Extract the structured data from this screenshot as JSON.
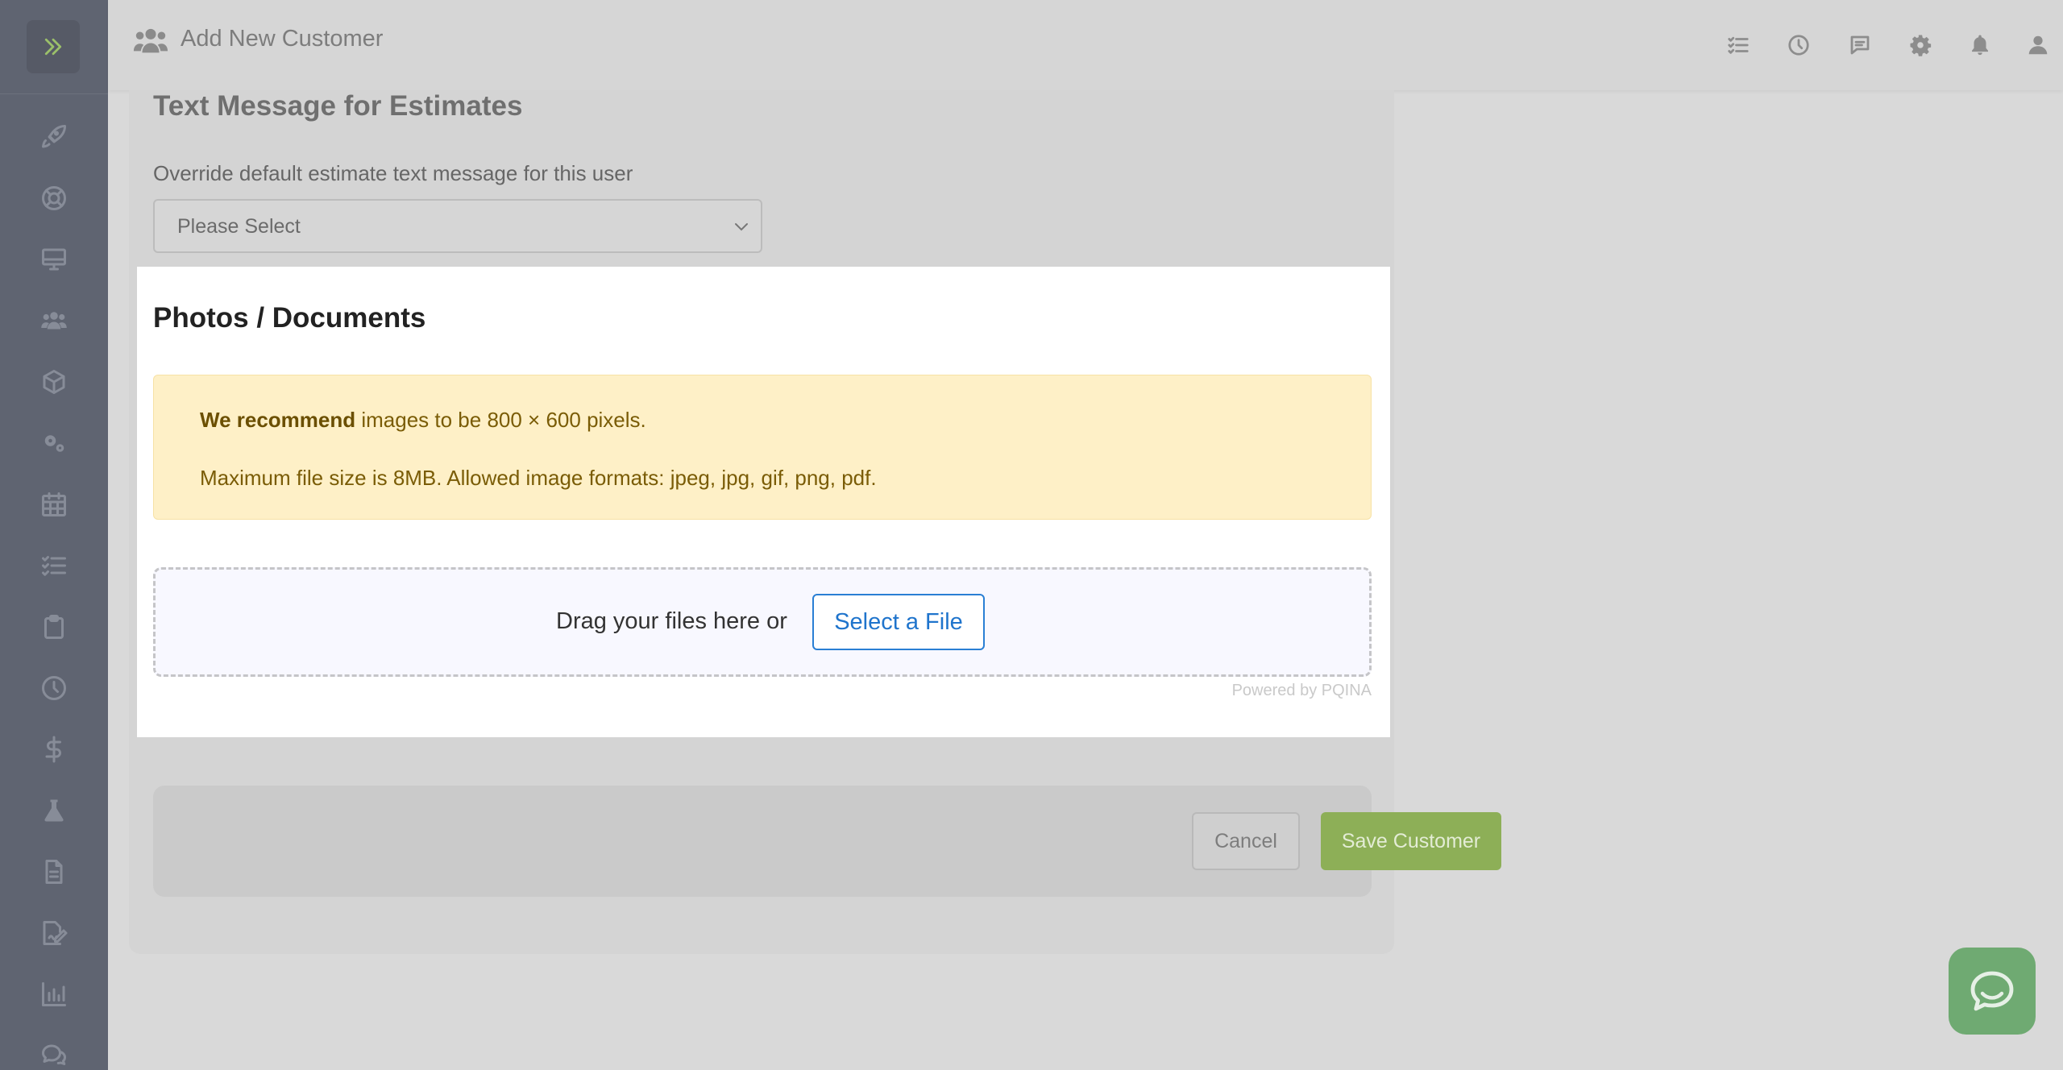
{
  "header": {
    "title": "Add New Customer",
    "title_icon": "users-icon",
    "icons": [
      "task-list-icon",
      "clock-icon",
      "message-icon",
      "gear-icon",
      "bell-icon",
      "user-icon"
    ]
  },
  "sidebar": {
    "toggle_icon": "double-chevron-right-icon",
    "items": [
      "rocket-icon",
      "lifebuoy-icon",
      "monitor-icon",
      "users-icon",
      "box-icon",
      "gears-icon",
      "calendar-icon",
      "checklist-icon",
      "clipboard-icon",
      "clock-icon",
      "dollar-icon",
      "flask-icon",
      "document-icon",
      "signature-icon",
      "bar-chart-icon",
      "chat-bubbles-icon"
    ]
  },
  "text_message": {
    "title": "Text Message for Estimates",
    "label": "Override default estimate text message for this user",
    "select_value": "Please Select"
  },
  "photos": {
    "title": "Photos / Documents",
    "alert_bold": "We recommend",
    "alert_line1_rest": " images to be 800 × 600 pixels.",
    "alert_line2": "Maximum file size is 8MB. Allowed image formats: jpeg, jpg, gif, png, pdf.",
    "drop_text": "Drag your files here or",
    "select_file_label": "Select a File",
    "powered_by": "Powered by PQINA"
  },
  "footer": {
    "cancel_label": "Cancel",
    "save_label": "Save Customer"
  },
  "colors": {
    "accent_green": "#8daf57",
    "link_blue": "#1f74cc",
    "alert_bg": "#fef0c7",
    "sidebar_bg": "#5f6471"
  }
}
